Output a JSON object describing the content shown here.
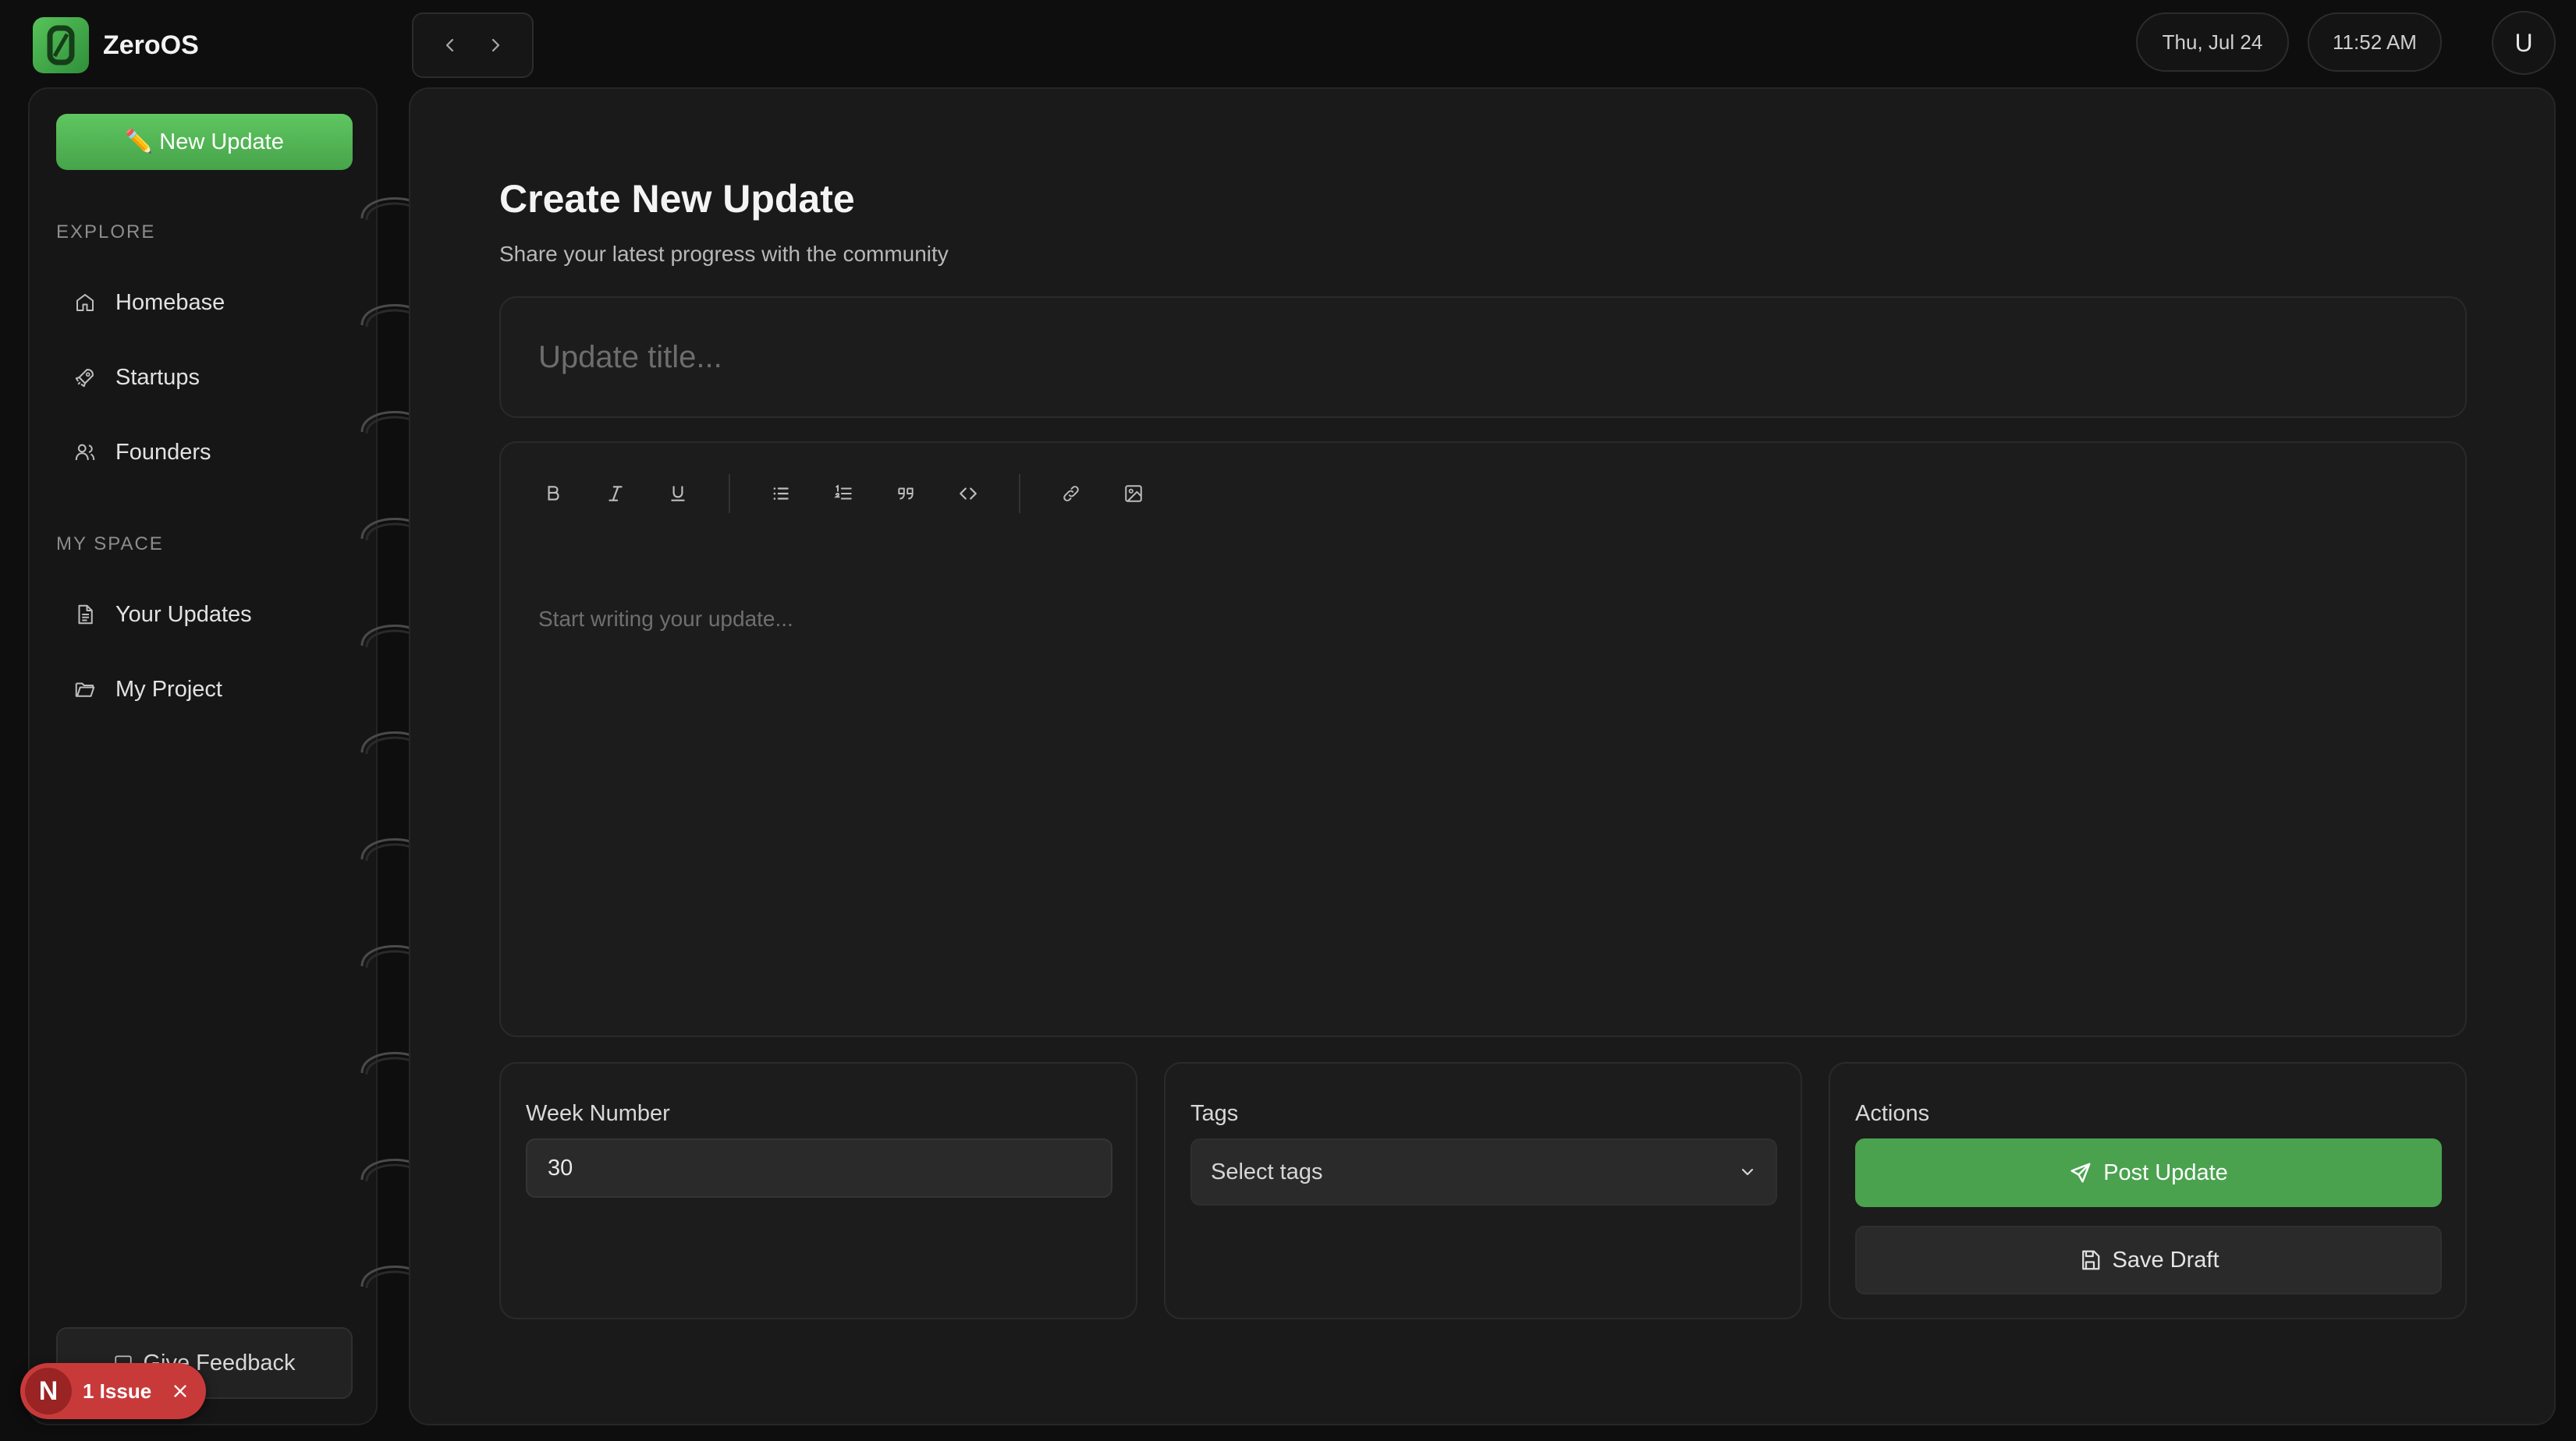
{
  "app": {
    "name": "ZeroOS"
  },
  "header": {
    "date": "Thu, Jul 24",
    "time": "11:52 AM",
    "avatar_initial": "U"
  },
  "sidebar": {
    "new_update_label": "✏️ New Update",
    "explore_label": "EXPLORE",
    "explore_items": [
      {
        "label": "Homebase",
        "icon": "home-icon"
      },
      {
        "label": "Startups",
        "icon": "rocket-icon"
      },
      {
        "label": "Founders",
        "icon": "users-icon"
      }
    ],
    "myspace_label": "MY SPACE",
    "myspace_items": [
      {
        "label": "Your Updates",
        "icon": "document-icon"
      },
      {
        "label": "My Project",
        "icon": "folder-icon"
      }
    ],
    "feedback_label": "Give Feedback"
  },
  "main": {
    "title": "Create New Update",
    "subtitle": "Share your latest progress with the community",
    "title_placeholder": "Update title...",
    "toolbar": [
      "bold-icon",
      "italic-icon",
      "underline-icon",
      "bullet-list-icon",
      "numbered-list-icon",
      "quote-icon",
      "code-icon",
      "link-icon",
      "image-icon"
    ],
    "body_placeholder": "Start writing your update...",
    "week": {
      "label": "Week Number",
      "value": "30"
    },
    "tags": {
      "label": "Tags",
      "placeholder": "Select tags"
    },
    "actions": {
      "label": "Actions",
      "post_label": "Post Update",
      "draft_label": "Save Draft"
    }
  },
  "issue_badge": {
    "initial": "N",
    "text": "1 Issue"
  },
  "colors": {
    "accent": "#4aa24f",
    "background": "#0e0e0e",
    "panel": "#1a1a1a",
    "issue": "#c83a3a"
  }
}
